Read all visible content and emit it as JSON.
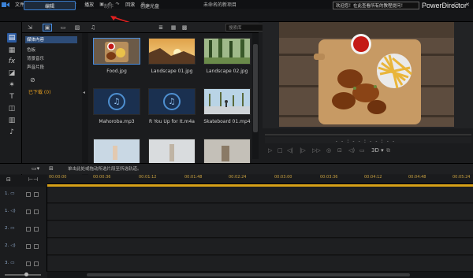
{
  "menubar": {
    "items": [
      "文件",
      "编辑",
      "插件",
      "查看",
      "播放"
    ],
    "extra": "回滚",
    "project_title": "未命名的新项目",
    "window_controls": [
      "—",
      "▢",
      "✕"
    ]
  },
  "tabs": {
    "edit": "编辑",
    "produce": "制作",
    "disc": "创建光盘"
  },
  "notice": "欢迎您！在此查看所有的教程提问！",
  "brand": "PowerDirector",
  "library": {
    "search_placeholder": "搜索库",
    "tree": [
      "媒体内容",
      "色板",
      "背景音乐",
      "声音片段"
    ],
    "downloaded": "已下载 (0)"
  },
  "media": [
    {
      "name": "Food.jpg",
      "kind": "photo",
      "selected": true
    },
    {
      "name": "Landscape 01.jpg",
      "kind": "photo",
      "selected": false
    },
    {
      "name": "Landscape 02.jpg",
      "kind": "photo",
      "selected": false
    },
    {
      "name": "Mahoroba.mp3",
      "kind": "music",
      "selected": false
    },
    {
      "name": "R You Up for It.m4a",
      "kind": "music",
      "selected": false
    },
    {
      "name": "Skateboard 01.mp4",
      "kind": "video",
      "selected": false
    },
    {
      "name": "",
      "kind": "video",
      "selected": false
    },
    {
      "name": "",
      "kind": "video",
      "selected": false
    },
    {
      "name": "",
      "kind": "video",
      "selected": false
    }
  ],
  "preview": {
    "timecode": "- - : - - : - - : - -",
    "mode_3d": "3D ▾"
  },
  "timeline": {
    "hint": "单击此处或拖动所选片段至所选轨道。",
    "ruler": [
      "00:00:00",
      "00:00:36",
      "00:01:12",
      "00:01:48",
      "00:02:24",
      "00:03:00",
      "00:03:36",
      "00:04:12",
      "00:04:48",
      "00:05:24"
    ],
    "tracks": [
      {
        "label": "1.",
        "type": "video"
      },
      {
        "label": "1.",
        "type": "audio"
      },
      {
        "label": "2.",
        "type": "video"
      },
      {
        "label": "2.",
        "type": "audio"
      },
      {
        "label": "3.",
        "type": "video"
      }
    ]
  }
}
